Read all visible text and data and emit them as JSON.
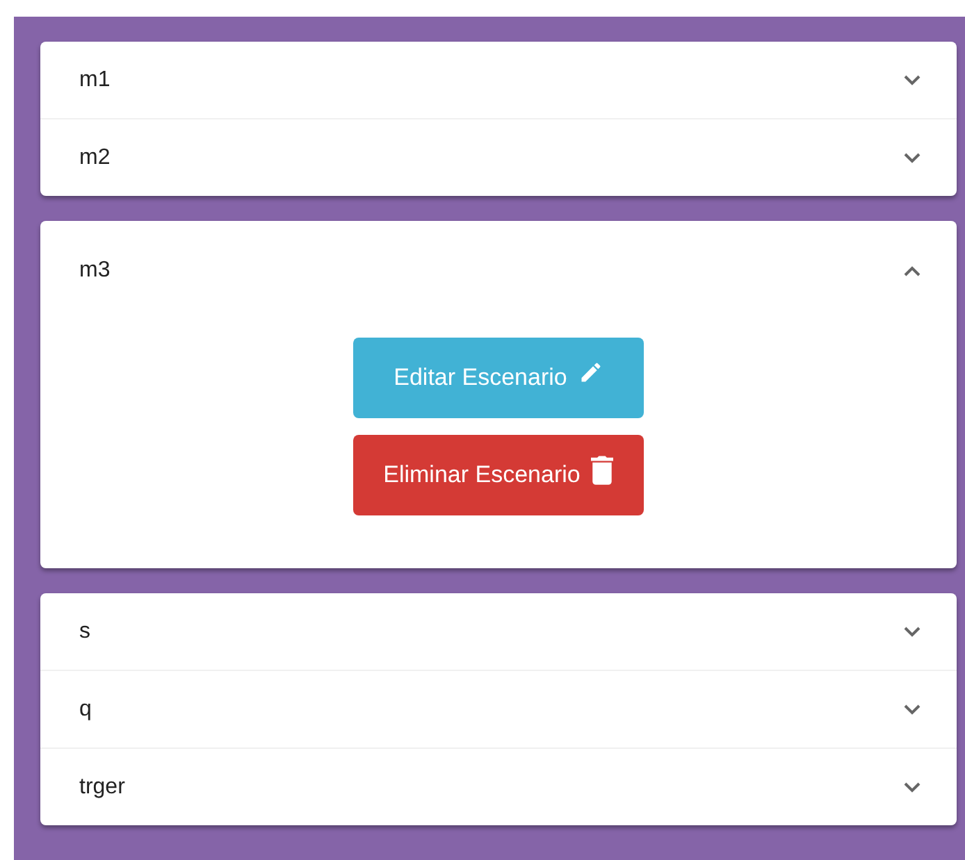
{
  "panels": [
    {
      "title": "m1",
      "expanded": false
    },
    {
      "title": "m2",
      "expanded": false
    },
    {
      "title": "m3",
      "expanded": true,
      "actions": [
        {
          "kind": "edit",
          "label": "Editar Escenario"
        },
        {
          "kind": "delete",
          "label": "Eliminar Escenario"
        }
      ]
    },
    {
      "title": "s",
      "expanded": false
    },
    {
      "title": "q",
      "expanded": false
    },
    {
      "title": "trger",
      "expanded": false
    }
  ]
}
